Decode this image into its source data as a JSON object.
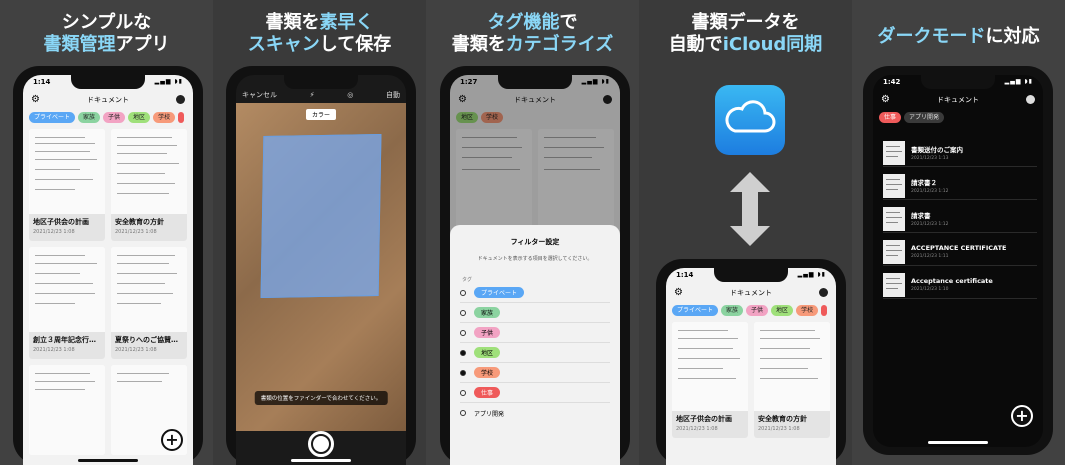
{
  "panels": [
    {
      "headline_a": "シンプルな",
      "headline_b1": "書類管理",
      "headline_b2": "アプリ"
    },
    {
      "headline_a1": "書類を",
      "headline_a2": "素早く",
      "headline_b1": "スキャン",
      "headline_b2": "して保存"
    },
    {
      "headline_a1": "タグ機能",
      "headline_a2": "で",
      "headline_b1": "書類を",
      "headline_b2": "カテゴライズ"
    },
    {
      "headline_a": "書類データを",
      "headline_b1": "自動で",
      "headline_b2": "iCloud同期"
    },
    {
      "headline_a1": "ダークモード",
      "headline_a2": "に対応"
    }
  ],
  "phone1": {
    "time": "1:14",
    "title": "ドキュメント",
    "tags": [
      {
        "label": "プライベート",
        "color": "#5aa7f5"
      },
      {
        "label": "家族",
        "color": "#8bd3a0"
      },
      {
        "label": "子供",
        "color": "#f2a3c3"
      },
      {
        "label": "地区",
        "color": "#9fe07a"
      },
      {
        "label": "学校",
        "color": "#f79a7a"
      },
      {
        "label": "",
        "color": "#ef5a5a"
      }
    ],
    "docs": [
      {
        "title": "地区子供会の計画",
        "date": "2021/12/23 1:08"
      },
      {
        "title": "安全教育の方針",
        "date": "2021/12/23 1:08"
      },
      {
        "title": "創立３周年記念行…",
        "date": "2021/12/23 1:08"
      },
      {
        "title": "夏祭りへのご協賛…",
        "date": "2021/12/23 1:08"
      }
    ]
  },
  "camera": {
    "cancel": "キャンセル",
    "auto": "自動",
    "color_mode": "カラー",
    "hint": "書類の位置をファインダーで合わせてください。"
  },
  "phone3": {
    "time": "1:27",
    "title": "ドキュメント",
    "tags": [
      {
        "label": "地区",
        "color": "#9fe07a"
      },
      {
        "label": "学校",
        "color": "#f79a7a"
      }
    ],
    "sheet": {
      "title": "フィルター設定",
      "desc": "ドキュメントを表示する項目を選択してください。",
      "section": "タグ",
      "items": [
        {
          "label": "プライベート",
          "color": "#5aa7f5",
          "checked": false
        },
        {
          "label": "家族",
          "color": "#8bd3a0",
          "checked": false
        },
        {
          "label": "子供",
          "color": "#f2a3c3",
          "checked": false
        },
        {
          "label": "地区",
          "color": "#9fe07a",
          "checked": true
        },
        {
          "label": "学校",
          "color": "#f79a7a",
          "checked": true
        },
        {
          "label": "仕事",
          "color": "#ef5a5a",
          "checked": false
        },
        {
          "label": "アプリ開発",
          "color": "",
          "checked": false
        }
      ]
    }
  },
  "phone4": {
    "time": "1:14",
    "title": "ドキュメント",
    "tags": [
      {
        "label": "プライベート",
        "color": "#5aa7f5"
      },
      {
        "label": "家族",
        "color": "#8bd3a0"
      },
      {
        "label": "子供",
        "color": "#f2a3c3"
      },
      {
        "label": "地区",
        "color": "#9fe07a"
      },
      {
        "label": "学校",
        "color": "#f79a7a"
      },
      {
        "label": "",
        "color": "#ef5a5a"
      }
    ],
    "docs": [
      {
        "title": "地区子供会の計画",
        "date": "2021/12/23 1:08"
      },
      {
        "title": "安全教育の方針",
        "date": "2021/12/23 1:08"
      }
    ]
  },
  "phone5": {
    "time": "1:42",
    "title": "ドキュメント",
    "tags": [
      {
        "label": "仕事",
        "color": "#ef5a5a"
      },
      {
        "label": "アプリ開発",
        "color": "#3a3a3a"
      }
    ],
    "docs": [
      {
        "title": "書類送付のご案内",
        "date": "2021/12/23 1:13"
      },
      {
        "title": "請求書２",
        "date": "2021/12/23 1:12"
      },
      {
        "title": "請求書",
        "date": "2021/12/23 1:12"
      },
      {
        "title": "ACCEPTANCE CERTIFICATE",
        "date": "2021/12/23 1:11"
      },
      {
        "title": "Acceptance certificate",
        "date": "2021/12/23 1:10"
      }
    ]
  }
}
